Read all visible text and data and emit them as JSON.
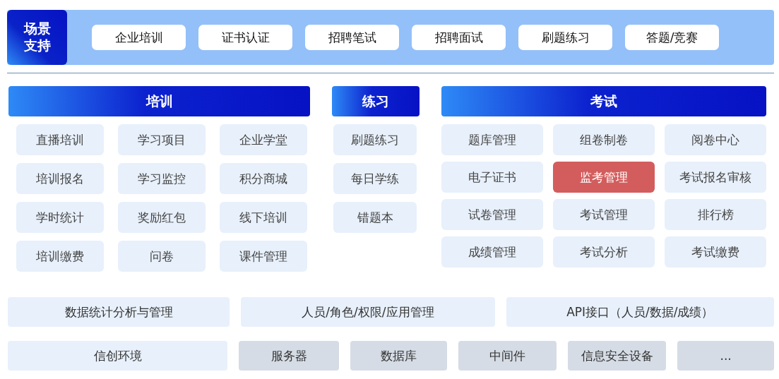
{
  "scenario_bar": {
    "label": "场景支持",
    "items": [
      {
        "label": "企业培训"
      },
      {
        "label": "证书认证"
      },
      {
        "label": "招聘笔试"
      },
      {
        "label": "招聘面试"
      },
      {
        "label": "刷题练习"
      },
      {
        "label": "答题/竞赛"
      }
    ]
  },
  "modules": [
    {
      "title": "培训",
      "items": [
        {
          "label": "直播培训",
          "selected": false
        },
        {
          "label": "学习项目",
          "selected": false
        },
        {
          "label": "企业学堂",
          "selected": false
        },
        {
          "label": "培训报名",
          "selected": false
        },
        {
          "label": "学习监控",
          "selected": false
        },
        {
          "label": "积分商城",
          "selected": false
        },
        {
          "label": "学时统计",
          "selected": false
        },
        {
          "label": "奖励红包",
          "selected": false
        },
        {
          "label": "线下培训",
          "selected": false
        },
        {
          "label": "培训缴费",
          "selected": false
        },
        {
          "label": "问卷",
          "selected": false
        },
        {
          "label": "课件管理",
          "selected": false
        }
      ]
    },
    {
      "title": "练习",
      "items": [
        {
          "label": "刷题练习",
          "selected": false
        },
        {
          "label": "每日学练",
          "selected": false
        },
        {
          "label": "错题本",
          "selected": false
        }
      ]
    },
    {
      "title": "考试",
      "items": [
        {
          "label": "题库管理",
          "selected": false
        },
        {
          "label": "组卷制卷",
          "selected": false
        },
        {
          "label": "阅卷中心",
          "selected": false
        },
        {
          "label": "电子证书",
          "selected": false
        },
        {
          "label": "监考管理",
          "selected": true
        },
        {
          "label": "考试报名审核",
          "selected": false
        },
        {
          "label": "试卷管理",
          "selected": false
        },
        {
          "label": "考试管理",
          "selected": false
        },
        {
          "label": "排行榜",
          "selected": false
        },
        {
          "label": "成绩管理",
          "selected": false
        },
        {
          "label": "考试分析",
          "selected": false
        },
        {
          "label": "考试缴费",
          "selected": false
        }
      ]
    }
  ],
  "foundation_rows": [
    [
      {
        "label": "数据统计分析与管理",
        "kind": "software"
      },
      {
        "label": "人员/角色/权限/应用管理",
        "kind": "software"
      },
      {
        "label": "API接口（人员/数据/成绩）",
        "kind": "software"
      }
    ],
    [
      {
        "label": "信创环境",
        "kind": "software"
      },
      {
        "label": "服务器",
        "kind": "hardware"
      },
      {
        "label": "数据库",
        "kind": "hardware"
      },
      {
        "label": "中间件",
        "kind": "hardware"
      },
      {
        "label": "信息安全设备",
        "kind": "hardware"
      },
      {
        "label": "...",
        "kind": "hardware"
      }
    ]
  ]
}
